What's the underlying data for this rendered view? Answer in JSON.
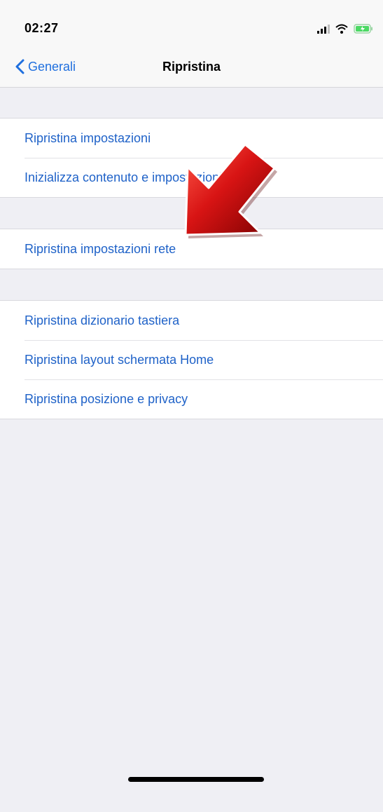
{
  "status_bar": {
    "time": "02:27",
    "icons": [
      "cellular-signal-icon",
      "wifi-icon",
      "battery-charging-icon"
    ]
  },
  "nav": {
    "back_label": "Generali",
    "title": "Ripristina"
  },
  "groups": [
    {
      "items": [
        {
          "label": "Ripristina impostazioni"
        },
        {
          "label": "Inizializza contenuto e impostazioni"
        }
      ]
    },
    {
      "items": [
        {
          "label": "Ripristina impostazioni rete"
        }
      ]
    },
    {
      "items": [
        {
          "label": "Ripristina dizionario tastiera"
        },
        {
          "label": "Ripristina layout schermata Home"
        },
        {
          "label": "Ripristina posizione e privacy"
        }
      ]
    }
  ],
  "annotation": {
    "icon": "red-arrow-icon",
    "color": "#d81414",
    "points_to": "Ripristina impostazioni rete"
  },
  "colors": {
    "accent": "#1f6fde",
    "link_text": "#1f62c8",
    "background": "#efeff4",
    "battery": "#4cd964"
  }
}
